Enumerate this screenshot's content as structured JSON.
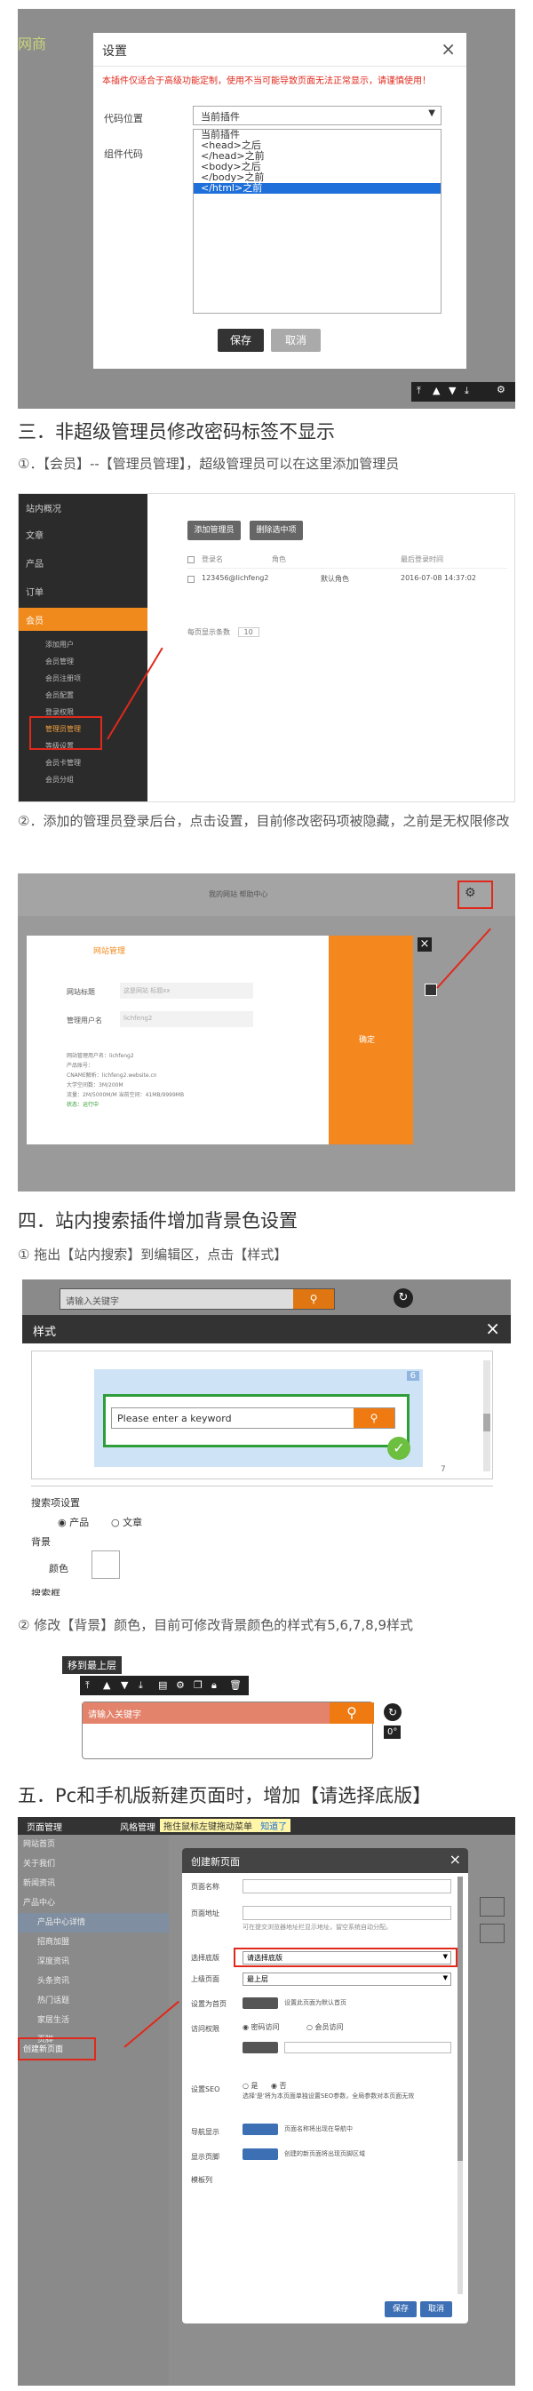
{
  "shot1": {
    "title": "设置",
    "warning": "本插件仅适合于高级功能定制，使用不当可能导致页面无法正常显示，请谨慎使用！",
    "pos_label": "代码位置",
    "pos_value": "当前插件",
    "code_label": "组件代码",
    "options": [
      "当前插件",
      "<head>之后",
      "</head>之前",
      "<body>之后",
      "</body>之前",
      "</html>之前"
    ],
    "save": "保存",
    "cancel": "取消",
    "brand": "网商"
  },
  "s3": {
    "heading": "三．非超级管理员修改密码标签不显示",
    "p1": "①．【会员】--【管理员管理】，超级管理员可以在这里添加管理员",
    "p2": "②．添加的管理员登录后台，点击设置，目前修改密码项被隐藏，之前是无权限修改"
  },
  "shot2": {
    "menu": [
      "站内概况",
      "文章",
      "产品",
      "订单",
      "会员"
    ],
    "sub": [
      "添加用户",
      "会员管理",
      "会员注册项",
      "会员配置",
      "登录权限",
      "管理员管理",
      "等级设置",
      "会员卡管理",
      "会员分组"
    ],
    "btn_add": "添加管理员",
    "btn_del": "删除选中项",
    "cols": [
      "登录名",
      "角色",
      "最后登录时间"
    ],
    "row": {
      "name": "123456@lichfeng2",
      "role": "默认角色",
      "time": "2016-07-08 14:37:02"
    },
    "pager": "每页显示条数",
    "pager_val": "10"
  },
  "shot3": {
    "fields": [
      {
        "label": "网站标题",
        "value": "这是网站 标题xx"
      },
      {
        "label": "管理用户名",
        "value": "lichfeng2"
      }
    ],
    "info": [
      "网站管理用户名：lichfeng2",
      "产品账号：",
      "CNAME解析：lichfeng2.website.cn",
      "大学空间数：3M/200M",
      "流量：2M/5000M/M  当前空间：41MB/9999MB",
      "状态：运行中"
    ],
    "confirm": "确定",
    "logo": "网站管理",
    "top_text": "我的网站  帮助中心"
  },
  "s4": {
    "heading": "四．站内搜索插件增加背景色设置",
    "p1": "① 拖出【站内搜索】到编辑区，点击【样式】",
    "p2": "② 修改【背景】颜色，目前可修改背景颜色的样式有5,6,7,8,9样式"
  },
  "shot4": {
    "title": "样式",
    "placeholder": "请输入关键字",
    "preview_placeholder": "Please enter a keyword",
    "num_top": "6",
    "num_bottom": "7",
    "settings": "搜索项设置",
    "opt1": "产品",
    "opt2": "文章",
    "bg": "背景",
    "color": "颜色",
    "search_box": "搜索框"
  },
  "shot5": {
    "tooltip": "移到最上层",
    "placeholder": "请输入关键字",
    "deg": "0°"
  },
  "s5": {
    "heading": "五．Pc和手机版新建页面时，增加【请选择底版】"
  },
  "shot6": {
    "tab1": "页面管理",
    "tab2": "风格管理",
    "notice": "拖住鼠标左键拖动菜单",
    "notice_link": "知道了",
    "tree": [
      "网站首页",
      "关于我们",
      "新闻资讯",
      "产品中心",
      "产品中心详情",
      "招商加盟",
      "深度资讯",
      "头条资讯",
      "热门话题",
      "家居生活",
      "页脚"
    ],
    "new_item": "创建新页面",
    "dialog": {
      "title": "创建新页面",
      "fields": [
        "页面名称",
        "页面地址",
        "选择底版",
        "上级页面",
        "设置为首页",
        "访问权限",
        "",
        "设置SEO",
        "导航显示",
        "显示页脚",
        "模板列"
      ],
      "hint": "可在提交浏览器地址栏显示地址，留空系统自动分配。",
      "base": "请选择底版",
      "parent": "最上层",
      "home_txt": "设置此页面为默认首页",
      "perm1": "密码访问",
      "perm2": "会员访问",
      "seo_a": "是",
      "seo_b": "否",
      "seo_note": "选择'是'将为本页面单独设置SEO参数，全局参数对本页面无效",
      "nav_txt": "页面名称将出现在导航中",
      "foot_txt": "创建的新页面将出现页脚区域",
      "save": "保存",
      "cancel": "取消"
    }
  }
}
